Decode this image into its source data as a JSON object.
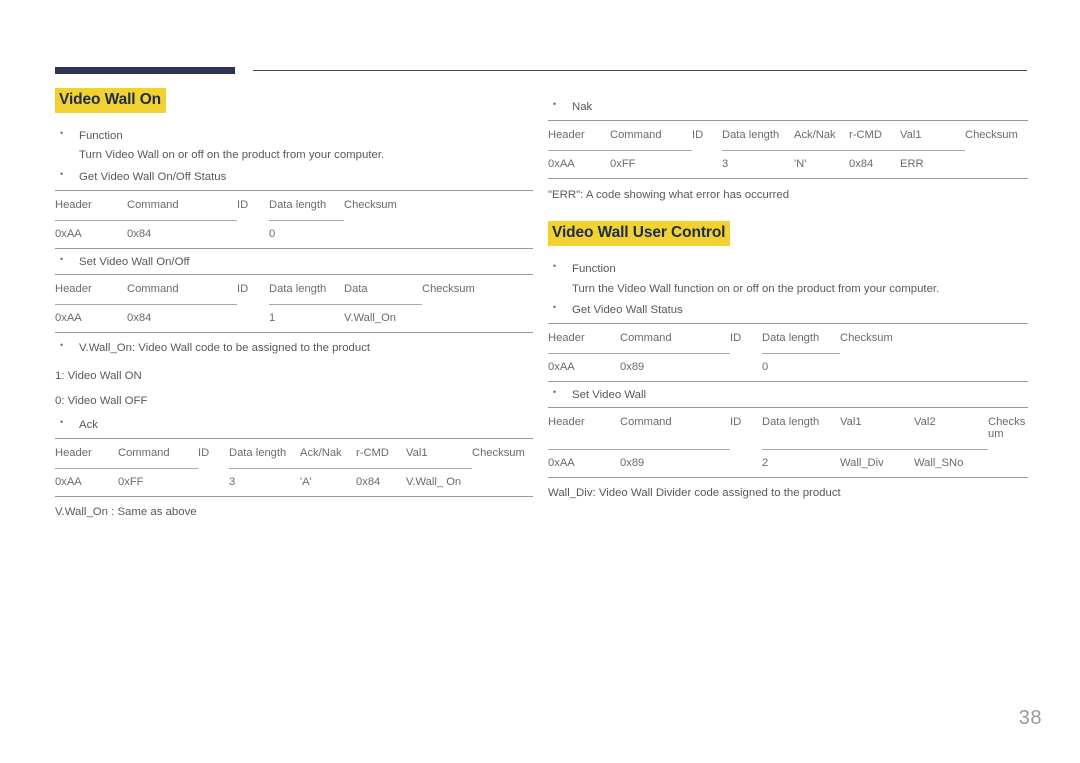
{
  "page": {
    "number": "38",
    "accent_navy": "#2e3455",
    "highlight_yellow": "#f2d22e",
    "rule_color": "#9a9a9a",
    "body_text_color": "#595959"
  },
  "left_column": {
    "heading": "Video Wall On",
    "function_label": "Function",
    "function_text": "Turn Video Wall on or off on the product from your computer.",
    "get_status_label": "Get Video Wall On/Off Status",
    "get_status_table": {
      "headers": [
        "Header",
        "Command",
        "ID",
        "Data length",
        "Checksum"
      ],
      "row": [
        "0xAA",
        "0x84",
        "",
        "0",
        ""
      ]
    },
    "set_label": "Set Video Wall On/Off",
    "set_table": {
      "headers": [
        "Header",
        "Command",
        "ID",
        "Data length",
        "Data",
        "Checksum"
      ],
      "row": [
        "0xAA",
        "0x84",
        "",
        "1",
        "V.Wall_On",
        ""
      ]
    },
    "code_note": "V.Wall_On: Video Wall code to be assigned to the product",
    "code_values": [
      "1: Video Wall ON",
      "0: Video Wall OFF"
    ],
    "ack_label": "Ack",
    "ack_table": {
      "headers": [
        "Header",
        "Command",
        "ID",
        "Data length",
        "Ack/Nak",
        "r-CMD",
        "Val1",
        "Checksum"
      ],
      "row": [
        "0xAA",
        "0xFF",
        "",
        "3",
        "'A'",
        "0x84",
        "V.Wall_ On",
        ""
      ]
    },
    "ack_note": "V.Wall_On : Same as above"
  },
  "right_column": {
    "nak_label": "Nak",
    "nak_table": {
      "headers": [
        "Header",
        "Command",
        "ID",
        "Data length",
        "Ack/Nak",
        "r-CMD",
        "Val1",
        "Checksum"
      ],
      "row": [
        "0xAA",
        "0xFF",
        "",
        "3",
        "'N'",
        "0x84",
        "ERR",
        ""
      ]
    },
    "nak_note": "\"ERR\": A code showing what error has occurred",
    "heading": "Video Wall User Control",
    "function_label": "Function",
    "function_text": "Turn the Video Wall function on or off on the product from your computer.",
    "get_status_label": "Get Video Wall Status",
    "get_status_table": {
      "headers": [
        "Header",
        "Command",
        "ID",
        "Data length",
        "Checksum"
      ],
      "row": [
        "0xAA",
        "0x89",
        "",
        "0",
        ""
      ]
    },
    "set_label": "Set Video Wall",
    "set_table": {
      "headers": [
        "Header",
        "Command",
        "ID",
        "Data length",
        "Val1",
        "Val2",
        "Checksum"
      ],
      "row": [
        "0xAA",
        "0x89",
        "",
        "2",
        "Wall_Div",
        "Wall_SNo",
        ""
      ]
    },
    "set_note": "Wall_Div: Video Wall Divider code assigned to the product"
  }
}
